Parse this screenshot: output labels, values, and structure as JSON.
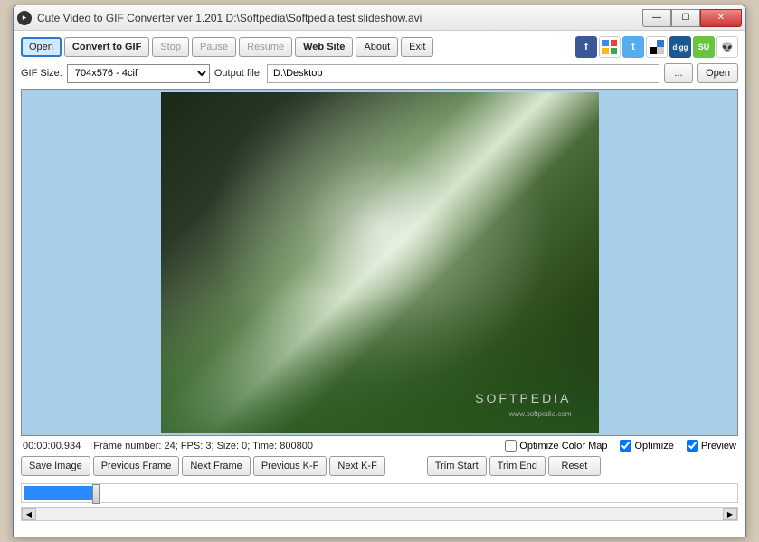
{
  "window": {
    "title": "Cute Video to GIF Converter ver 1.201   D:\\Softpedia\\Softpedia test slideshow.avi"
  },
  "toolbar": {
    "open": "Open",
    "convert": "Convert to GIF",
    "stop": "Stop",
    "pause": "Pause",
    "resume": "Resume",
    "website": "Web Site",
    "about": "About",
    "exit": "Exit"
  },
  "social": {
    "items": [
      {
        "name": "facebook",
        "bg": "#3b5998",
        "txt": "f"
      },
      {
        "name": "google",
        "bg": "#fff",
        "txt": ""
      },
      {
        "name": "twitter",
        "bg": "#55acee",
        "txt": "t"
      },
      {
        "name": "delicious",
        "bg": "#fff",
        "txt": ""
      },
      {
        "name": "digg",
        "bg": "#1b5891",
        "txt": "digg"
      },
      {
        "name": "stumbleupon",
        "bg": "#6bc43f",
        "txt": "SU"
      },
      {
        "name": "reddit",
        "bg": "#fff",
        "txt": ""
      }
    ]
  },
  "row2": {
    "gifsize_label": "GIF Size:",
    "gifsize_value": "704x576 - 4cif",
    "output_label": "Output file:",
    "output_value": "D:\\Desktop",
    "browse": "...",
    "open": "Open"
  },
  "watermark": {
    "main": "SOFTPEDIA",
    "sub": "www.softpedia.com"
  },
  "status": {
    "time": "00:00:00.934",
    "info": "Frame number: 24; FPS: 3; Size: 0; Time: 800800",
    "optimize_colormap": "Optimize Color Map",
    "optimize_colormap_checked": false,
    "optimize": "Optimize",
    "optimize_checked": true,
    "preview": "Preview",
    "preview_checked": true
  },
  "toolbar3": {
    "save_image": "Save Image",
    "prev_frame": "Previous Frame",
    "next_frame": "Next Frame",
    "prev_kf": "Previous K-F",
    "next_kf": "Next K-F",
    "trim_start": "Trim Start",
    "trim_end": "Trim End",
    "reset": "Reset"
  }
}
